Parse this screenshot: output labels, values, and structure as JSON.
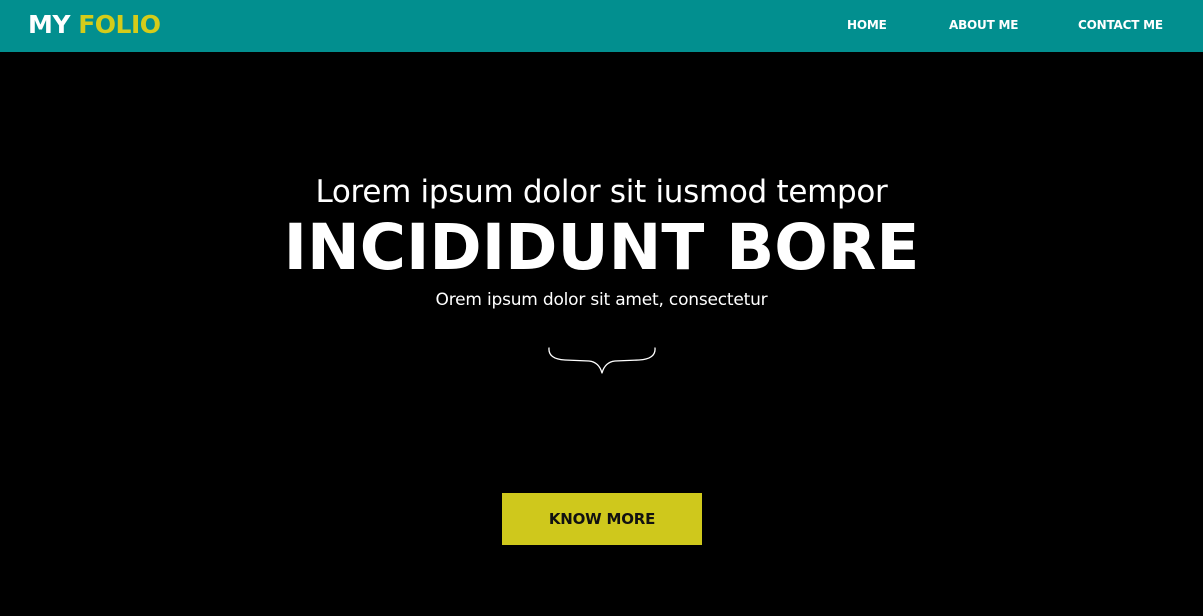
{
  "navbar": {
    "brand": {
      "word1": "MY",
      "word2": "FOLIO"
    },
    "links": [
      {
        "label": "HOME"
      },
      {
        "label": "ABOUT ME"
      },
      {
        "label": "CONTACT ME"
      }
    ]
  },
  "hero": {
    "tagline": "Lorem ipsum dolor sit iusmod tempor",
    "headline": "INCIDIDUNT BORE",
    "subline": "Orem ipsum dolor sit amet, consectetur",
    "divider_icon": "curly-brace-icon",
    "cta_label": "KNOW MORE"
  },
  "colors": {
    "navbar_bg": "#028f8f",
    "brand_accent": "#d4cc1a",
    "hero_bg": "#000000",
    "cta_bg": "#cfc81c",
    "text": "#ffffff"
  }
}
